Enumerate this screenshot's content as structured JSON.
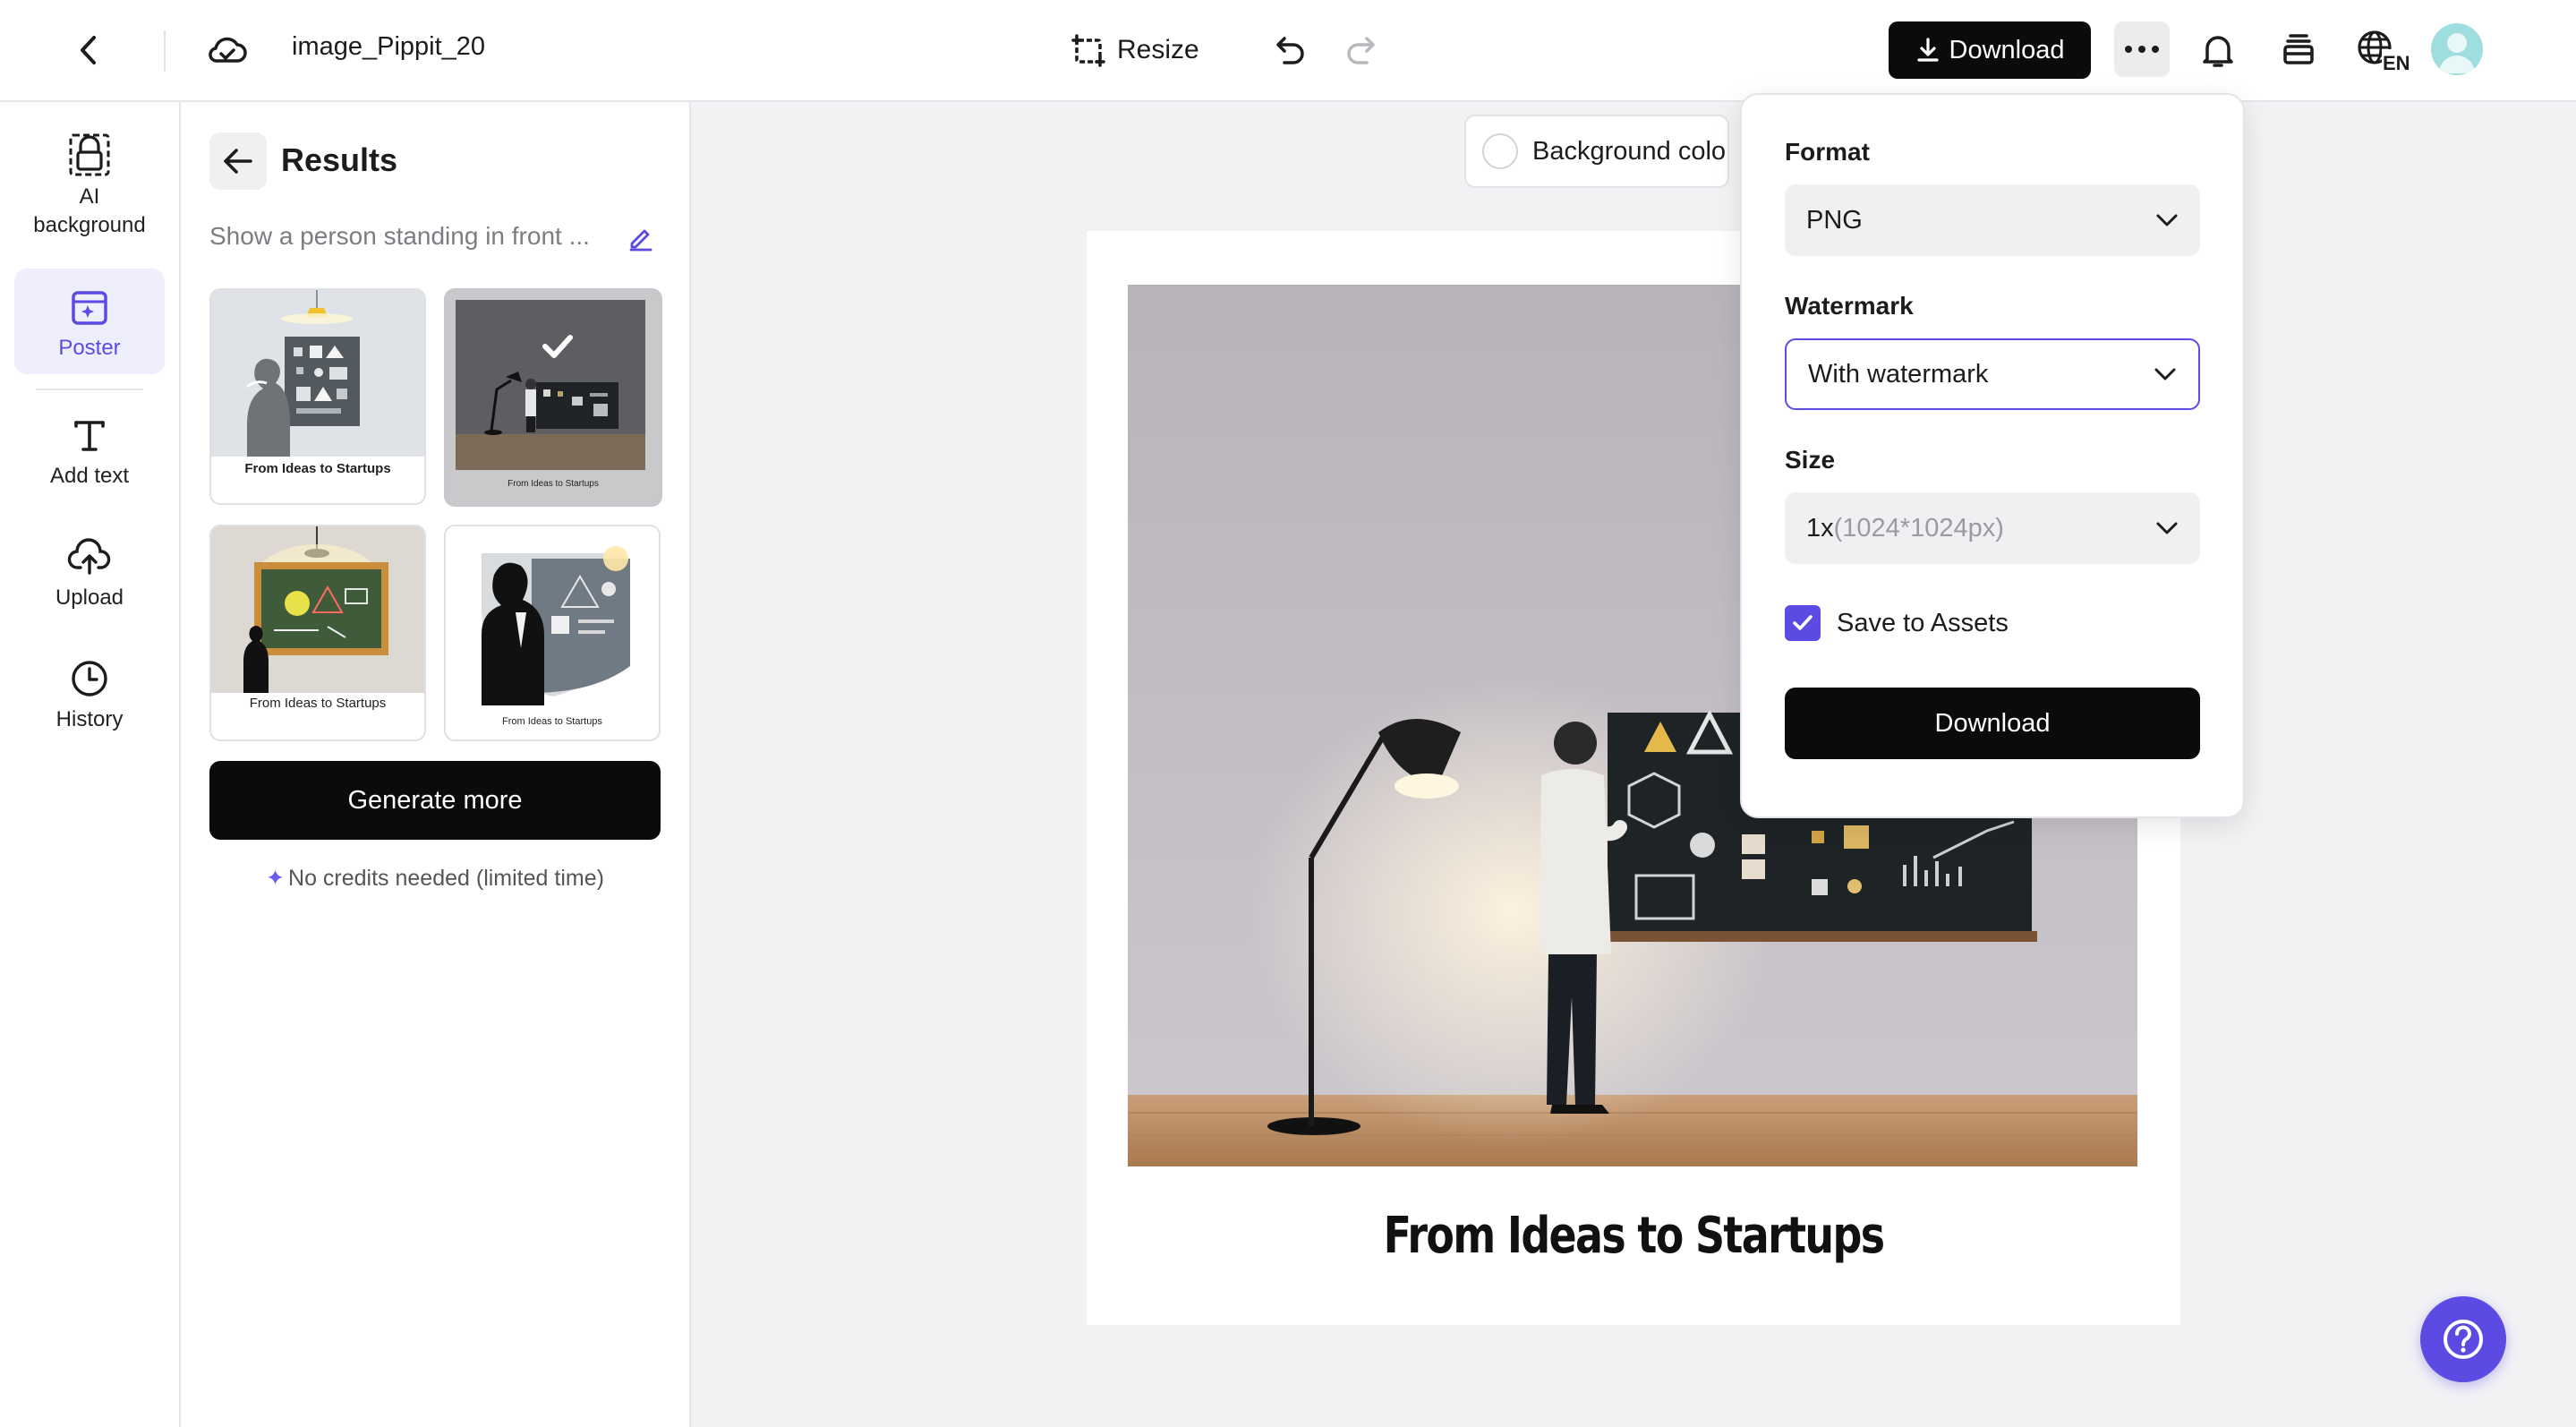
{
  "header": {
    "file_name": "image_Pippit_20",
    "resize_label": "Resize",
    "download_label": "Download",
    "lang": "EN"
  },
  "rail": {
    "items": [
      {
        "label": "AI background",
        "icon": "ai-background-icon"
      },
      {
        "label": "Poster",
        "icon": "poster-icon",
        "active": true
      },
      {
        "label": "Add text",
        "icon": "text-icon"
      },
      {
        "label": "Upload",
        "icon": "upload-cloud-icon"
      },
      {
        "label": "History",
        "icon": "clock-icon"
      }
    ]
  },
  "results": {
    "title": "Results",
    "prompt": "Show a person standing in front ...",
    "thumbnails": [
      {
        "caption": "From Ideas to Startups",
        "selected": false
      },
      {
        "caption": "From Ideas to Startups",
        "selected": true
      },
      {
        "caption": "From Ideas to Startups",
        "selected": false
      },
      {
        "caption": "From Ideas to Startups",
        "selected": false
      }
    ],
    "generate_label": "Generate more",
    "note": "No credits needed (limited time)"
  },
  "canvas": {
    "bg_color_label": "Background color",
    "poster_caption": "From Ideas to Startups"
  },
  "download_panel": {
    "format_label": "Format",
    "format_value": "PNG",
    "watermark_label": "Watermark",
    "watermark_value": "With watermark",
    "size_label": "Size",
    "size_value": "1x",
    "size_detail": "(1024*1024px)",
    "save_assets_label": "Save to Assets",
    "save_assets_checked": true,
    "download_label": "Download"
  },
  "colors": {
    "accent": "#5b4be3",
    "primary_button": "#0b0b0c"
  }
}
